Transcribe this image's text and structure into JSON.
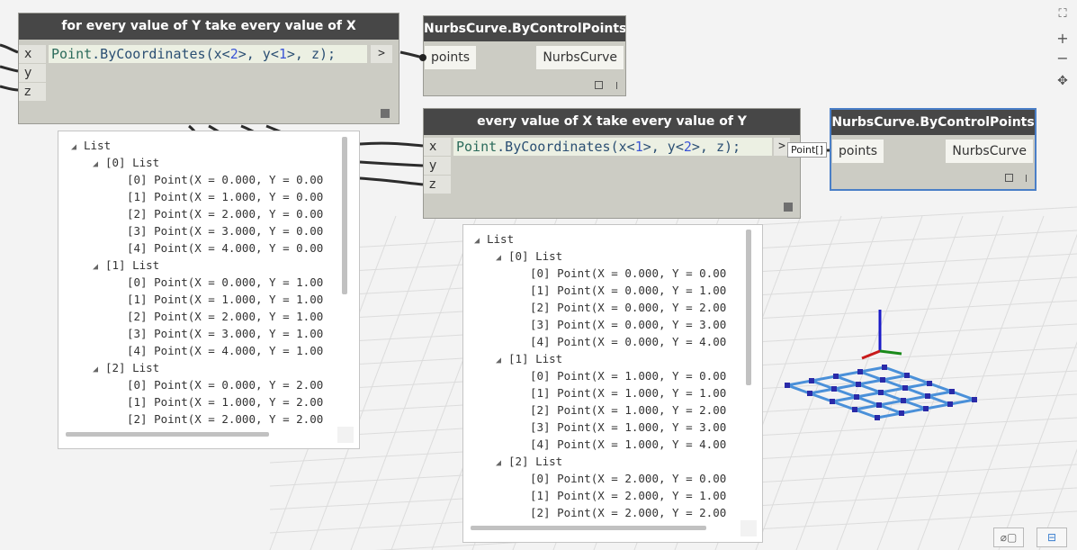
{
  "node1": {
    "title": "for every value of Y take every value of X",
    "ports": [
      "x",
      "y",
      "z"
    ],
    "code_cls": "Point",
    "code_fn": ".ByCoordinates(x<",
    "code_a": "2",
    "code_mid": ">, y<",
    "code_b": "1",
    "code_end": ">, z);",
    "out_label": ">"
  },
  "node2": {
    "title": "NurbsCurve.ByControlPoints",
    "input": "points",
    "output": "NurbsCurve"
  },
  "node3": {
    "title": "every value of X take every value of Y",
    "ports": [
      "x",
      "y",
      "z"
    ],
    "code_cls": "Point",
    "code_fn": ".ByCoordinates(x<",
    "code_a": "1",
    "code_mid": ">, y<",
    "code_b": "2",
    "code_end": ">, z);",
    "out_label": ">",
    "tooltip": "Point[]"
  },
  "node4": {
    "title": "NurbsCurve.ByControlPoints",
    "input": "points",
    "output": "NurbsCurve"
  },
  "preview1": {
    "rows": [
      {
        "indent": 0,
        "tri": "◢",
        "text": "List"
      },
      {
        "indent": 1,
        "tri": "◢",
        "text": "[0] List"
      },
      {
        "indent": 2,
        "tri": "",
        "text": "[0] Point(X = 0.000, Y = 0.00"
      },
      {
        "indent": 2,
        "tri": "",
        "text": "[1] Point(X = 1.000, Y = 0.00"
      },
      {
        "indent": 2,
        "tri": "",
        "text": "[2] Point(X = 2.000, Y = 0.00"
      },
      {
        "indent": 2,
        "tri": "",
        "text": "[3] Point(X = 3.000, Y = 0.00"
      },
      {
        "indent": 2,
        "tri": "",
        "text": "[4] Point(X = 4.000, Y = 0.00"
      },
      {
        "indent": 1,
        "tri": "◢",
        "text": "[1] List"
      },
      {
        "indent": 2,
        "tri": "",
        "text": "[0] Point(X = 0.000, Y = 1.00"
      },
      {
        "indent": 2,
        "tri": "",
        "text": "[1] Point(X = 1.000, Y = 1.00"
      },
      {
        "indent": 2,
        "tri": "",
        "text": "[2] Point(X = 2.000, Y = 1.00"
      },
      {
        "indent": 2,
        "tri": "",
        "text": "[3] Point(X = 3.000, Y = 1.00"
      },
      {
        "indent": 2,
        "tri": "",
        "text": "[4] Point(X = 4.000, Y = 1.00"
      },
      {
        "indent": 1,
        "tri": "◢",
        "text": "[2] List"
      },
      {
        "indent": 2,
        "tri": "",
        "text": "[0] Point(X = 0.000, Y = 2.00"
      },
      {
        "indent": 2,
        "tri": "",
        "text": "[1] Point(X = 1.000, Y = 2.00"
      },
      {
        "indent": 2,
        "tri": "",
        "text": "[2] Point(X = 2.000, Y = 2.00"
      }
    ]
  },
  "preview2": {
    "rows": [
      {
        "indent": 0,
        "tri": "◢",
        "text": "List"
      },
      {
        "indent": 1,
        "tri": "◢",
        "text": "[0] List"
      },
      {
        "indent": 2,
        "tri": "",
        "text": "[0] Point(X = 0.000, Y = 0.00"
      },
      {
        "indent": 2,
        "tri": "",
        "text": "[1] Point(X = 0.000, Y = 1.00"
      },
      {
        "indent": 2,
        "tri": "",
        "text": "[2] Point(X = 0.000, Y = 2.00"
      },
      {
        "indent": 2,
        "tri": "",
        "text": "[3] Point(X = 0.000, Y = 3.00"
      },
      {
        "indent": 2,
        "tri": "",
        "text": "[4] Point(X = 0.000, Y = 4.00"
      },
      {
        "indent": 1,
        "tri": "◢",
        "text": "[1] List"
      },
      {
        "indent": 2,
        "tri": "",
        "text": "[0] Point(X = 1.000, Y = 0.00"
      },
      {
        "indent": 2,
        "tri": "",
        "text": "[1] Point(X = 1.000, Y = 1.00"
      },
      {
        "indent": 2,
        "tri": "",
        "text": "[2] Point(X = 1.000, Y = 2.00"
      },
      {
        "indent": 2,
        "tri": "",
        "text": "[3] Point(X = 1.000, Y = 3.00"
      },
      {
        "indent": 2,
        "tri": "",
        "text": "[4] Point(X = 1.000, Y = 4.00"
      },
      {
        "indent": 1,
        "tri": "◢",
        "text": "[2] List"
      },
      {
        "indent": 2,
        "tri": "",
        "text": "[0] Point(X = 2.000, Y = 0.00"
      },
      {
        "indent": 2,
        "tri": "",
        "text": "[1] Point(X = 2.000, Y = 1.00"
      },
      {
        "indent": 2,
        "tri": "",
        "text": "[2] Point(X = 2.000, Y = 2.00"
      }
    ]
  },
  "zoom": {
    "fit": "⛶",
    "plus": "+",
    "minus": "−",
    "pan": "✥"
  },
  "bottom": {
    "geom": "⌀▢",
    "graph": "⊟"
  },
  "colors": {
    "wire": "#2c2c2c",
    "node_bg": "#ccccc4",
    "title_bg": "#474747",
    "select": "#4a7fc7",
    "curve": "#4a90d9",
    "point": "#2a2aa8"
  }
}
